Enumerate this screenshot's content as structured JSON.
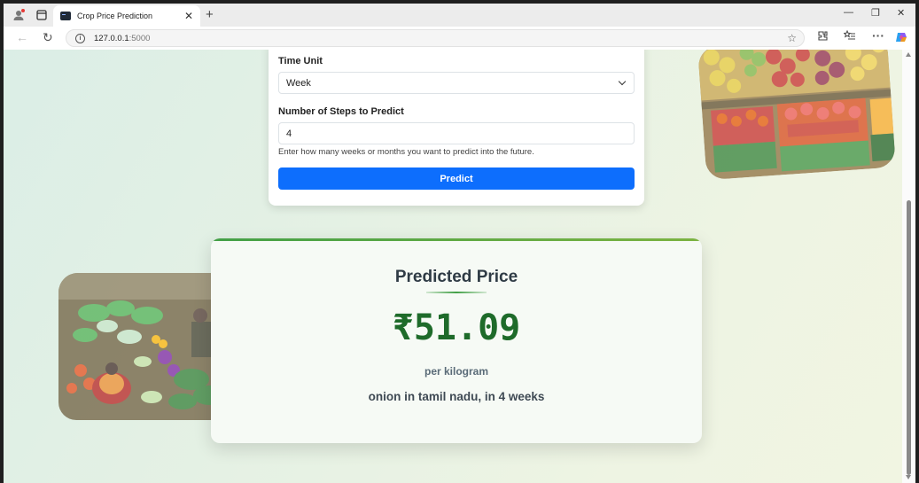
{
  "browser": {
    "tab_title": "Crop Price Prediction",
    "url_host": "127.0.0.1",
    "url_port": ":5000",
    "tab_close": "✕",
    "new_tab": "+",
    "window_controls": {
      "minimize": "—",
      "restore": "❐",
      "close": "✕"
    }
  },
  "form": {
    "time_unit_label": "Time Unit",
    "time_unit_value": "Week",
    "steps_label": "Number of Steps to Predict",
    "steps_value": "4",
    "help_text": "Enter how many weeks or months you want to predict into the future.",
    "predict_button": "Predict"
  },
  "result": {
    "title": "Predicted Price",
    "price": "₹51.09",
    "unit": "per kilogram",
    "description": "onion in tamil nadu, in 4 weeks"
  },
  "colors": {
    "primary_button": "#0d6efd",
    "price_green": "#1e6b2a",
    "accent_bar": "#43a047"
  },
  "icons": [
    "profile-icon",
    "tab-actions-icon",
    "back-icon",
    "refresh-icon",
    "site-info-icon",
    "favorite-star-icon",
    "extensions-icon",
    "favorites-icon",
    "more-icon",
    "copilot-icon",
    "chevron-down-icon"
  ]
}
